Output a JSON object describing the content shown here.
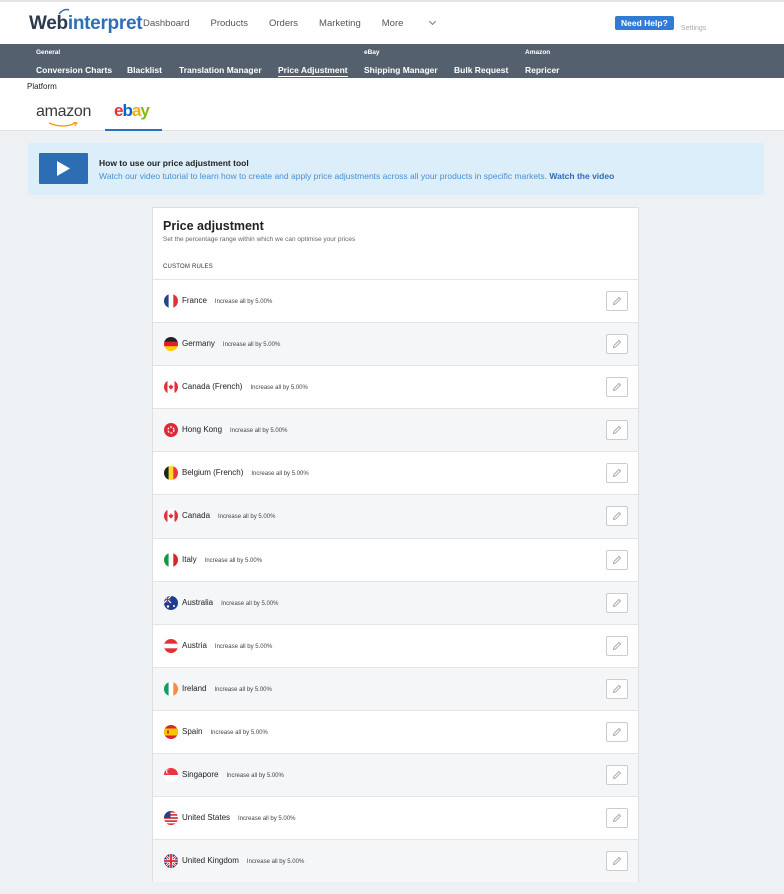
{
  "brand": {
    "logo_main": "Web",
    "logo_accent": "interpret"
  },
  "nav": {
    "items": [
      "Dashboard",
      "Products",
      "Orders",
      "Marketing"
    ],
    "more_label": "More"
  },
  "header": {
    "help_label": "Need Help?",
    "settings_label": "Settings"
  },
  "subnav": {
    "groups": {
      "general": "General",
      "ebay": "eBay",
      "amazon": "Amazon"
    },
    "items": [
      "Conversion Charts",
      "Blacklist",
      "Translation Manager",
      "Price Adjustment",
      "Shipping Manager",
      "Bulk Request",
      "Repricer"
    ],
    "active": "Price Adjustment"
  },
  "platform": {
    "label": "Platform",
    "amazon": "amazon",
    "ebay_letters": [
      "e",
      "b",
      "a",
      "y"
    ],
    "selected": "ebay"
  },
  "banner": {
    "title": "How to use our price adjustment tool",
    "text": "Watch our video tutorial to learn how to create and apply price adjustments across all your products in specific markets.",
    "link": "Watch the video"
  },
  "card": {
    "title": "Price adjustment",
    "subtitle": "Set the percentage range within which we can optimise your prices",
    "section_label": "CUSTOM RULES"
  },
  "rules": [
    {
      "country": "France",
      "rule": "Increase all by 5.00%"
    },
    {
      "country": "Germany",
      "rule": "Increase all by 5.00%"
    },
    {
      "country": "Canada (French)",
      "rule": "Increase all by 5.00%"
    },
    {
      "country": "Hong Kong",
      "rule": "Increase all by 5.00%"
    },
    {
      "country": "Belgium (French)",
      "rule": "Increase all by 5.00%"
    },
    {
      "country": "Canada",
      "rule": "Increase all by 5.00%"
    },
    {
      "country": "Italy",
      "rule": "Increase all by 5.00%"
    },
    {
      "country": "Australia",
      "rule": "Increase all by 5.00%"
    },
    {
      "country": "Austria",
      "rule": "Increase all by 5.00%"
    },
    {
      "country": "Ireland",
      "rule": "Increase all by 5.00%"
    },
    {
      "country": "Spain",
      "rule": "Increase all by 5.00%"
    },
    {
      "country": "Singapore",
      "rule": "Increase all by 5.00%"
    },
    {
      "country": "United States",
      "rule": "Increase all by 5.00%"
    },
    {
      "country": "United Kingdom",
      "rule": "Increase all by 5.00%"
    }
  ],
  "colors": {
    "accent": "#2f6fb8",
    "subnav_bg": "#55606e",
    "banner_bg": "#dceef9",
    "help_bg": "#2f7bd6"
  }
}
